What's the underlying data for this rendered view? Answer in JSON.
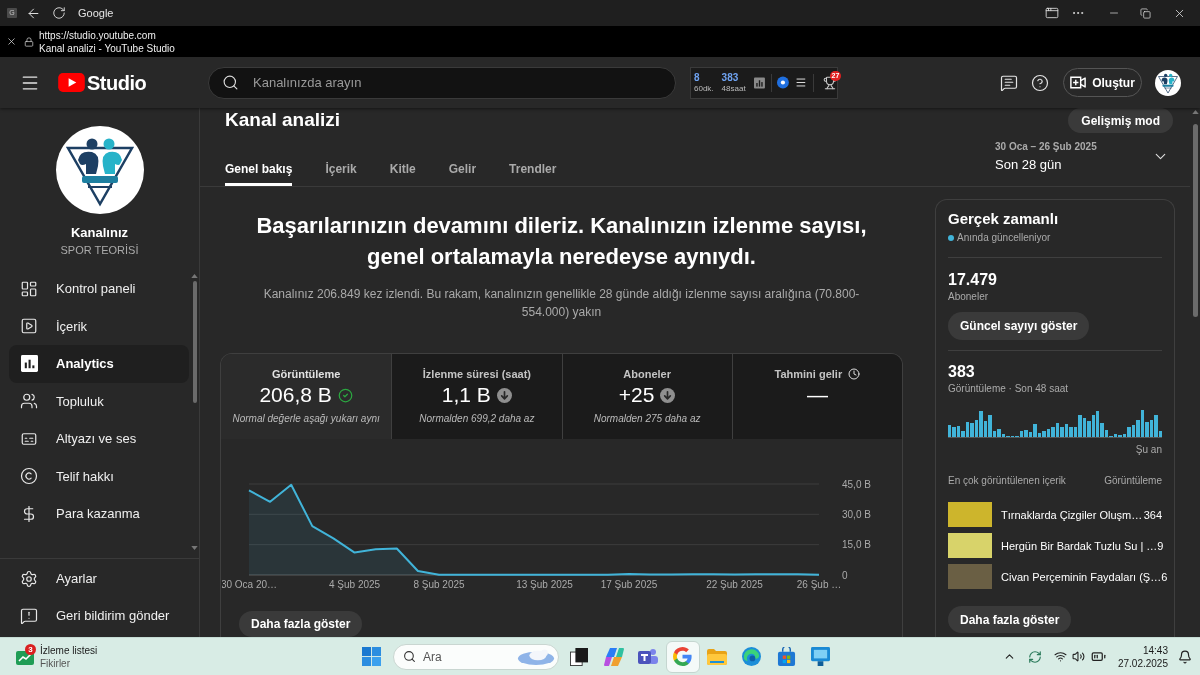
{
  "browser": {
    "app_icon": "G",
    "title": "Google",
    "url": "https://studio.youtube.com",
    "page_title": "Kanal analizi - YouTube Studio"
  },
  "header": {
    "logo_text": "Studio",
    "search": {
      "placeholder": "Kanalınızda arayın"
    },
    "extension": {
      "stats": [
        {
          "value": "8",
          "label": "60dk."
        },
        {
          "value": "383",
          "label": "48saat"
        }
      ],
      "badge": "27"
    },
    "create_button": "Oluştur"
  },
  "sidebar": {
    "channel_title": "Kanalınız",
    "channel_name": "SPOR TEORİSİ",
    "items": [
      {
        "label": "Kontrol paneli",
        "selected": false
      },
      {
        "label": "İçerik",
        "selected": false
      },
      {
        "label": "Analytics",
        "selected": true
      },
      {
        "label": "Topluluk",
        "selected": false
      },
      {
        "label": "Altyazı ve ses",
        "selected": false
      },
      {
        "label": "Telif hakkı",
        "selected": false
      },
      {
        "label": "Para kazanma",
        "selected": false
      }
    ],
    "footer_items": [
      "Ayarlar",
      "Geri bildirim gönder"
    ]
  },
  "page": {
    "title": "Kanal analizi",
    "advanced_button": "Gelişmiş mod",
    "tabs": [
      {
        "label": "Genel bakış",
        "selected": true
      },
      {
        "label": "İçerik",
        "selected": false
      },
      {
        "label": "Kitle",
        "selected": false
      },
      {
        "label": "Gelir",
        "selected": false
      },
      {
        "label": "Trendler",
        "selected": false
      }
    ],
    "date_range": {
      "dates": "30 Oca – 26 Şub 2025",
      "label": "Son 28 gün"
    }
  },
  "summary": {
    "headline": "Başarılarınızın devamını dileriz. Kanalınızın izlenme sayısı, genel ortalamayla neredeyse aynıydı.",
    "text": "Kanalınız 206.849 kez izlendi. Bu rakam, kanalınızın genellikle 28 günde aldığı izlenme sayısı aralığına (70.800-554.000) yakın"
  },
  "overview": {
    "metrics": [
      {
        "label": "Görüntüleme",
        "value": "206,8 B",
        "note": "Normal değerle aşağı yukarı aynı",
        "kind": "normal",
        "selected": true
      },
      {
        "label": "İzlenme süresi (saat)",
        "value": "1,1 B",
        "note": "Normalden 699,2 daha az",
        "kind": "below",
        "selected": false
      },
      {
        "label": "Aboneler",
        "value": "+25",
        "note": "Normalden 275 daha az",
        "kind": "below",
        "selected": false
      },
      {
        "label": "Tahmini gelir",
        "value": "—",
        "kind": "pending",
        "selected": false
      }
    ],
    "chart_data": {
      "type": "area",
      "categories": [
        "30 Oca 20…",
        null,
        null,
        null,
        null,
        "4 Şub 2025",
        null,
        null,
        null,
        "8 Şub 2025",
        null,
        null,
        null,
        null,
        "13 Şub 2025",
        null,
        null,
        null,
        "17 Şub 2025",
        null,
        null,
        null,
        null,
        "22 Şub 2025",
        null,
        null,
        null,
        "26 Şub …"
      ],
      "ylim": [
        0,
        45
      ],
      "yticks": [
        {
          "value": 0,
          "label": "0"
        },
        {
          "value": 15,
          "label": "15,0 B"
        },
        {
          "value": 30,
          "label": "30,0 B"
        },
        {
          "value": 45,
          "label": "45,0 B"
        }
      ],
      "series": [
        {
          "color": "#41b4d9",
          "values": [
            41.9,
            36.2,
            44.6,
            24.2,
            18.1,
            11.1,
            12.7,
            13.1,
            2.0,
            0.1,
            0.1,
            0.1,
            0.1,
            0.1,
            0.1,
            0.1,
            0.1,
            0.1,
            0.5,
            0.2,
            0.2,
            0.4,
            0.4,
            0.2,
            0.4,
            0.4,
            0.4,
            0.1
          ]
        }
      ]
    },
    "more_button": "Daha fazla göster"
  },
  "realtime": {
    "title": "Gerçek zamanlı",
    "status": "Anında güncelleniyor",
    "subscribers": "17.479",
    "subscribers_label": "Aboneler",
    "show_button": "Güncel sayıyı göster",
    "views": "383",
    "views_label": "Görüntüleme · Son 48 saat",
    "now_label": "Şu an",
    "top_header": "En çok görüntülenen içerik",
    "top_views_header": "Görüntüleme",
    "top_content": [
      {
        "title": "Tırnaklarda Çizgiler Oluşm…",
        "views": "364"
      },
      {
        "title": "Hergün Bir Bardak Tuzlu Su | …",
        "views": "9"
      },
      {
        "title": "Civan Perçeminin Faydaları (Ş…",
        "views": "6"
      }
    ],
    "more_button": "Daha fazla göster"
  },
  "taskbar": {
    "widget": {
      "badge": "3",
      "title": "İzleme listesi",
      "subtitle": "Fikirler"
    },
    "search": {
      "placeholder": "Ara"
    },
    "apps": [
      {
        "kind": "taskview",
        "selected": false
      },
      {
        "kind": "copilot",
        "selected": false
      },
      {
        "kind": "teams",
        "selected": false
      },
      {
        "kind": "google",
        "selected": true
      },
      {
        "kind": "files",
        "selected": false
      },
      {
        "kind": "edge",
        "selected": false
      },
      {
        "kind": "store",
        "selected": false
      },
      {
        "kind": "app",
        "selected": false
      }
    ],
    "time": "14:43",
    "date": "27.02.2025"
  }
}
